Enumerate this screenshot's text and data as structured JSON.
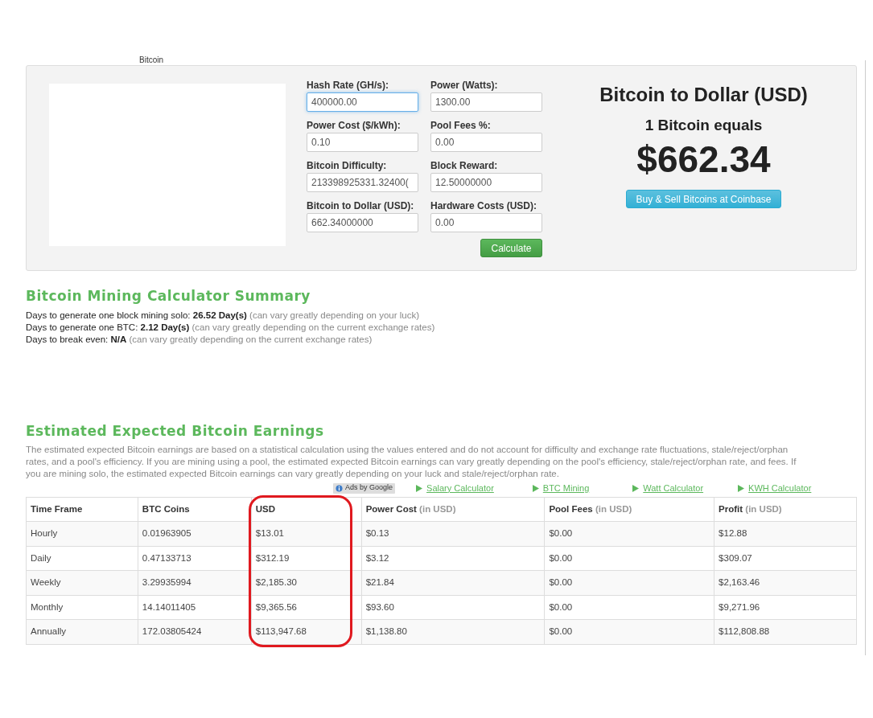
{
  "cut_label": "Bitcoin",
  "form": {
    "fields": [
      {
        "label": "Hash Rate (GH/s):",
        "value": "400000.00",
        "focused": true
      },
      {
        "label": "Power (Watts):",
        "value": "1300.00",
        "focused": false
      },
      {
        "label": "Power Cost ($/kWh):",
        "value": "0.10",
        "focused": false
      },
      {
        "label": "Pool Fees %:",
        "value": "0.00",
        "focused": false
      },
      {
        "label": "Bitcoin Difficulty:",
        "value": "213398925331.32400(",
        "focused": false
      },
      {
        "label": "Block Reward:",
        "value": "12.50000000",
        "focused": false
      },
      {
        "label": "Bitcoin to Dollar (USD):",
        "value": "662.34000000",
        "focused": false
      },
      {
        "label": "Hardware Costs (USD):",
        "value": "0.00",
        "focused": false
      }
    ],
    "button": "Calculate"
  },
  "rate": {
    "title": "Bitcoin to Dollar (USD)",
    "subtitle": "1 Bitcoin equals",
    "price": "$662.34",
    "button": "Buy & Sell Bitcoins at Coinbase"
  },
  "summary": {
    "title": "Bitcoin Mining Calculator Summary",
    "lines": [
      {
        "label": "Days to generate one block mining solo:",
        "value": "26.52 Day(s)",
        "note": "(can vary greatly depending on your luck)"
      },
      {
        "label": "Days to generate one BTC:",
        "value": "2.12 Day(s)",
        "note": "(can vary greatly depending on the current exchange rates)"
      },
      {
        "label": "Days to break even:",
        "value": "N/A",
        "note": "(can vary greatly depending on the current exchange rates)"
      }
    ]
  },
  "earnings": {
    "title": "Estimated Expected Bitcoin Earnings",
    "description": "The estimated expected Bitcoin earnings are based on a statistical calculation using the values entered and do not account for difficulty and exchange rate fluctuations, stale/reject/orphan rates, and a pool's efficiency. If you are mining using a pool, the estimated expected Bitcoin earnings can vary greatly depending on the pool's efficiency, stale/reject/orphan rate, and fees. If you are mining solo, the estimated expected Bitcoin earnings can vary greatly depending on your luck and stale/reject/orphan rate.",
    "ads_badge": "Ads by Google",
    "links": [
      "Salary Calculator",
      "BTC Mining",
      "Watt Calculator",
      "KWH Calculator"
    ],
    "table": {
      "columns": [
        {
          "label": "Time Frame",
          "highlighted": false
        },
        {
          "label": "BTC Coins",
          "highlighted": false
        },
        {
          "label": "USD",
          "highlighted": true
        },
        {
          "label": "Power Cost",
          "unit": "(in USD)",
          "highlighted": false
        },
        {
          "label": "Pool Fees",
          "unit": "(in USD)",
          "highlighted": false
        },
        {
          "label": "Profit",
          "unit": "(in USD)",
          "highlighted": false
        }
      ],
      "rows": [
        [
          "Hourly",
          "0.01963905",
          "$13.01",
          "$0.13",
          "$0.00",
          "$12.88"
        ],
        [
          "Daily",
          "0.47133713",
          "$312.19",
          "$3.12",
          "$0.00",
          "$309.07"
        ],
        [
          "Weekly",
          "3.29935994",
          "$2,185.30",
          "$21.84",
          "$0.00",
          "$2,163.46"
        ],
        [
          "Monthly",
          "14.14011405",
          "$9,365.56",
          "$93.60",
          "$0.00",
          "$9,271.96"
        ],
        [
          "Annually",
          "172.03805424",
          "$113,947.68",
          "$1,138.80",
          "$0.00",
          "$112,808.88"
        ]
      ]
    }
  }
}
